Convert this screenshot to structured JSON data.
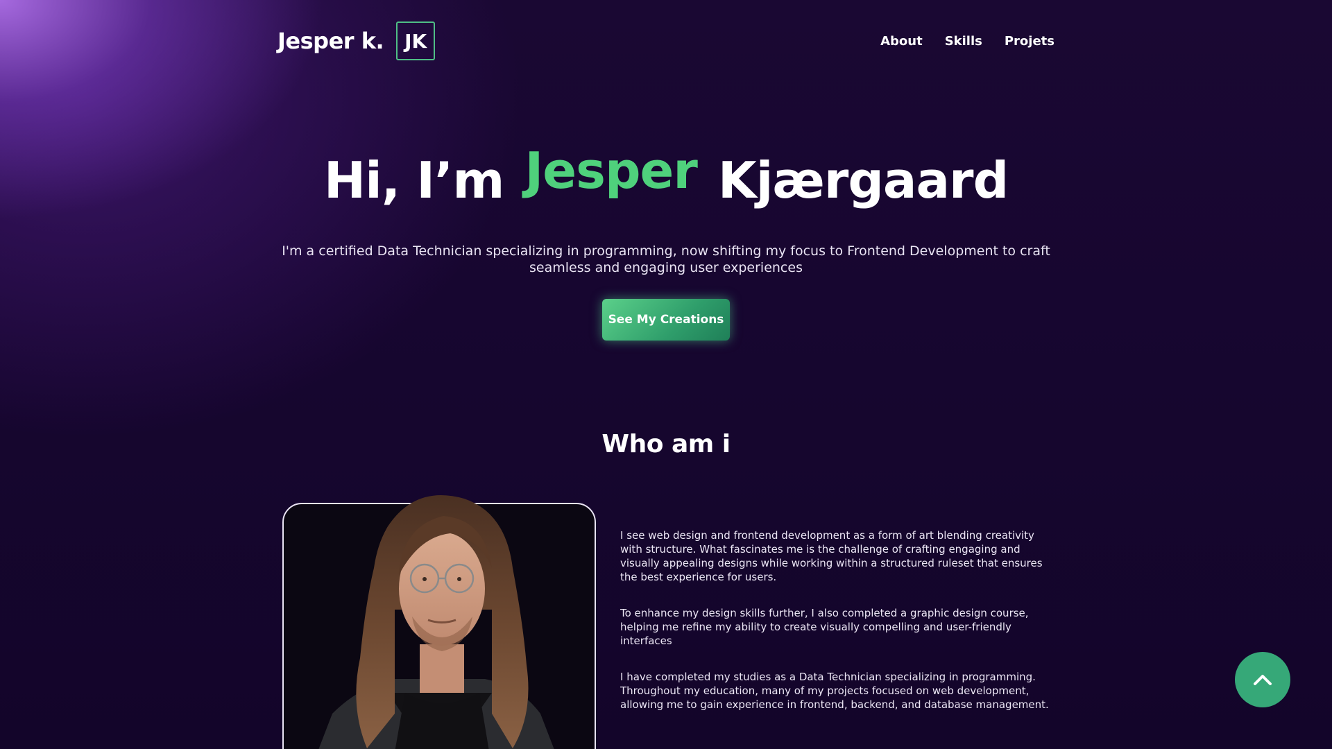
{
  "header": {
    "logo_text": "Jesper k.",
    "logo_badge": "JK",
    "nav": [
      {
        "label": "About"
      },
      {
        "label": "Skills"
      },
      {
        "label": "Projets"
      }
    ]
  },
  "hero": {
    "title_prefix": "Hi, I’m",
    "title_accent": "Jesper",
    "title_suffix": "Kjærgaard",
    "subtitle": "I'm a certified Data Technician specializing in programming, now shifting my focus to Frontend Development to craft seamless and engaging user experiences",
    "cta_label": "See My Creations"
  },
  "about": {
    "title": "Who am i",
    "paragraphs": [
      "I see web design and frontend development as a form of art blending creativity with structure. What fascinates me is the challenge of crafting engaging and visually appealing designs while working within a structured ruleset that ensures the best experience for users.",
      "To enhance my design skills further, I also completed a graphic design course, helping me refine my ability to create visually compelling and user-friendly interfaces",
      "I have completed my studies as a Data Technician specializing in programming. Throughout my education, many of my projects focused on web development, allowing me to gain experience in frontend, backend, and database management."
    ]
  },
  "icons": {
    "scroll_top": "chevron-up-icon",
    "photo": "portrait-photo"
  },
  "colors": {
    "accent": "#4fd17c",
    "cta_start": "#5bd08a",
    "cta_end": "#1f7f58",
    "scroll_button": "#36a878",
    "background": "#140726"
  }
}
